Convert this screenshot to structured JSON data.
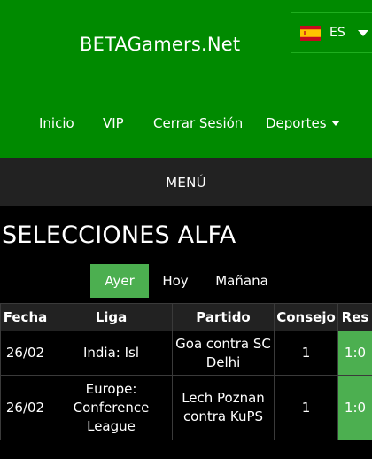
{
  "header": {
    "site_title": "BETAGamers.Net",
    "language": {
      "code": "ES",
      "flag_icon": "spain-flag-icon"
    }
  },
  "nav": [
    {
      "label": "Inicio"
    },
    {
      "label": "VIP"
    },
    {
      "label": "Cerrar Sesión"
    },
    {
      "label": "Deportes",
      "has_dropdown": true
    }
  ],
  "menu": {
    "label": "MENÚ"
  },
  "page": {
    "title": "SELECCIONES ALFA"
  },
  "tabs": [
    {
      "label": "Ayer",
      "active": true
    },
    {
      "label": "Hoy",
      "active": false
    },
    {
      "label": "Mañana",
      "active": false
    }
  ],
  "table": {
    "headers": [
      "Fecha",
      "Liga",
      "Partido",
      "Consejo",
      "Res"
    ],
    "rows": [
      {
        "fecha": "26/02",
        "liga": "India: Isl",
        "partido": "Goa contra SC Delhi",
        "consejo": "1",
        "res": "1:0"
      },
      {
        "fecha": "26/02",
        "liga": "Europe: Conference League",
        "partido": "Lech Poznan contra KuPS",
        "consejo": "1",
        "res": "1:0"
      }
    ]
  },
  "colors": {
    "header_bg": "#008a00",
    "active_tab": "#4caf50",
    "result_win": "#4caf50",
    "menu_bg": "#222222",
    "page_bg": "#000000"
  }
}
